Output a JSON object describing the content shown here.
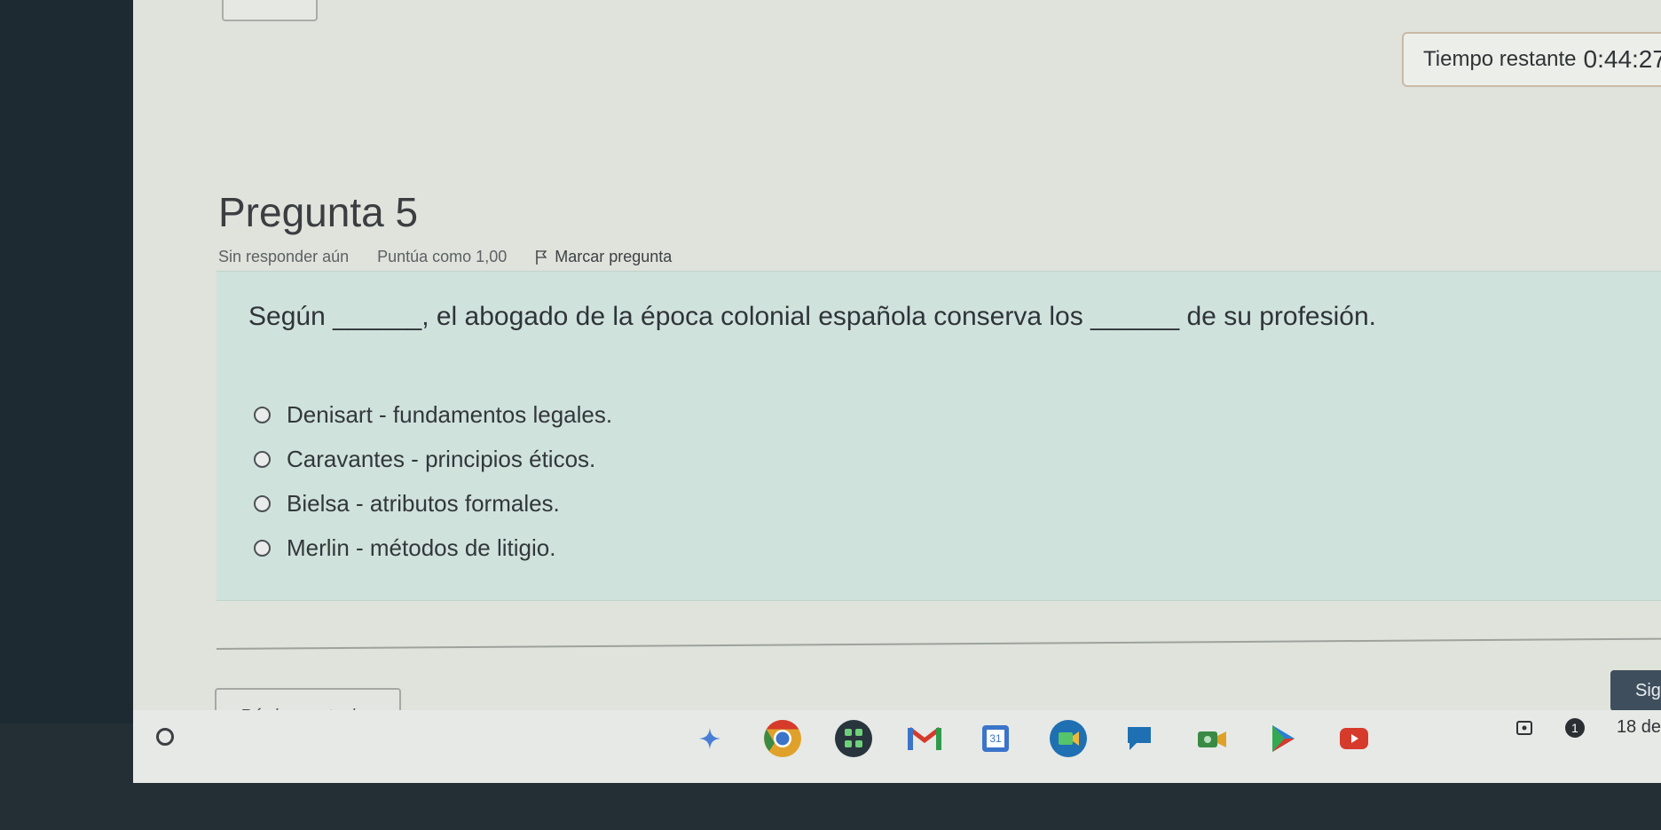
{
  "timer": {
    "label": "Tiempo restante",
    "value": "0:44:27"
  },
  "question": {
    "title": "Pregunta 5",
    "status": "Sin responder aún",
    "score": "Puntúa como 1,00",
    "flag_label": "Marcar pregunta",
    "text": "Según ______, el abogado de la época colonial española conserva los ______ de su profesión.",
    "options": [
      "Denisart - fundamentos legales.",
      "Caravantes - principios éticos.",
      "Bielsa - atributos formales.",
      "Merlin - métodos de litigio."
    ]
  },
  "navigation": {
    "prev_label": "Página anterior",
    "next_label": "Sig"
  },
  "shelf": {
    "apps": [
      "gemini-icon",
      "chrome-icon",
      "classroom-icon",
      "gmail-icon",
      "calendar-icon",
      "meet-icon",
      "chat-icon",
      "camera-icon",
      "play-store-icon",
      "youtube-icon"
    ],
    "calendar_day": "31",
    "notification_count": "1",
    "date": "18 de"
  },
  "colors": {
    "question_box": "#d0e2dc",
    "screen_bg": "#dfe3dc",
    "next_button": "#3f4e5c"
  }
}
